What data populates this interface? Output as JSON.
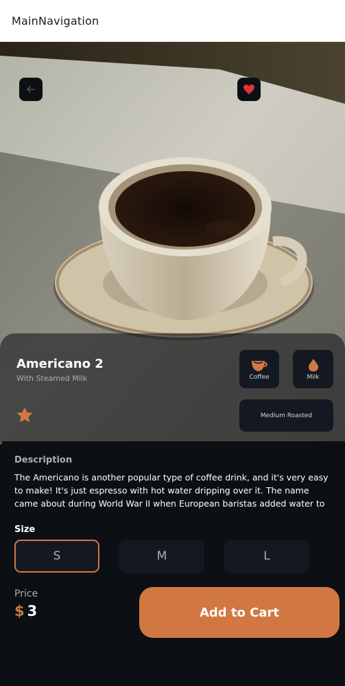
{
  "appbar": {
    "title": "MainNavigation"
  },
  "product": {
    "name": "Americano 2",
    "subtitle": "With Steamed Milk",
    "chips": {
      "coffee": "Coffee",
      "milk": "Milk",
      "roast": "Medium Roasted"
    }
  },
  "description": {
    "title": "Description",
    "text": "The Americano is another popular type of coffee drink, and it's very easy to make! It's just espresso with hot water dripping over it. The name came about during World War II when European baristas added water to their"
  },
  "size": {
    "title": "Size",
    "options": [
      "S",
      "M",
      "L"
    ],
    "selected": "S"
  },
  "price": {
    "label": "Price",
    "currency": "$",
    "value": "3"
  },
  "cart": {
    "label": "Add to Cart"
  },
  "icons": {
    "back": "arrow-left-icon",
    "favorite": "heart-icon",
    "rating": "star-icon",
    "coffee": "coffee-cup-icon",
    "milk": "drop-icon"
  },
  "colors": {
    "accent": "#D17842",
    "background": "#0C0F14",
    "card": "#141921",
    "favorite": "#DC3535"
  }
}
